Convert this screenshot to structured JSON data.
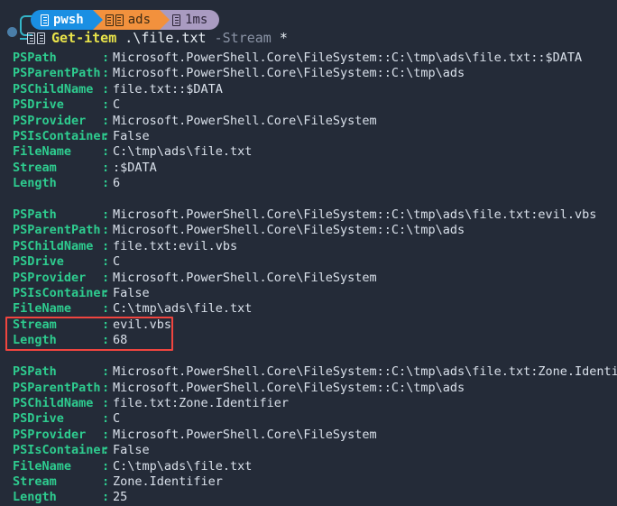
{
  "terminal": {
    "background_color": "#242b38",
    "prompt": {
      "segments": [
        {
          "name": "shell",
          "label": "pwsh",
          "icon": "terminal-glyph-icon",
          "bg_color": "#1a8fe3",
          "fg_color": "#ffffff"
        },
        {
          "name": "directory",
          "label": "ads",
          "icon": "folder-glyph-icon",
          "bg_color": "#f2913d",
          "fg_color": "#3b2a14"
        },
        {
          "name": "duration",
          "label": "1ms",
          "icon": "clock-glyph-icon",
          "bg_color": "#a99bc1",
          "fg_color": "#2b2438"
        }
      ],
      "command": {
        "icon": "prompt-glyph-icon",
        "name": "Get-item",
        "arg": " .\\file.txt",
        "param": " -Stream",
        "star": " *"
      }
    },
    "highlight": {
      "color": "#f0453f",
      "target_rows": [
        "Stream",
        "Length"
      ],
      "target_block_index": 1
    },
    "blocks": [
      {
        "id": "stream-data-default",
        "rows": [
          {
            "key": "PSPath",
            "colon": ":",
            "value": "Microsoft.PowerShell.Core\\FileSystem::C:\\tmp\\ads\\file.txt::$DATA"
          },
          {
            "key": "PSParentPath",
            "colon": ":",
            "value": "Microsoft.PowerShell.Core\\FileSystem::C:\\tmp\\ads"
          },
          {
            "key": "PSChildName",
            "colon": ":",
            "value": "file.txt::$DATA"
          },
          {
            "key": "PSDrive",
            "colon": ":",
            "value": "C"
          },
          {
            "key": "PSProvider",
            "colon": ":",
            "value": "Microsoft.PowerShell.Core\\FileSystem"
          },
          {
            "key": "PSIsContainer",
            "colon": ":",
            "value": "False"
          },
          {
            "key": "FileName",
            "colon": ":",
            "value": "C:\\tmp\\ads\\file.txt"
          },
          {
            "key": "Stream",
            "colon": ":",
            "value": ":$DATA"
          },
          {
            "key": "Length",
            "colon": ":",
            "value": "6"
          }
        ]
      },
      {
        "id": "stream-evil-vbs",
        "rows": [
          {
            "key": "PSPath",
            "colon": ":",
            "value": "Microsoft.PowerShell.Core\\FileSystem::C:\\tmp\\ads\\file.txt:evil.vbs"
          },
          {
            "key": "PSParentPath",
            "colon": ":",
            "value": "Microsoft.PowerShell.Core\\FileSystem::C:\\tmp\\ads"
          },
          {
            "key": "PSChildName",
            "colon": ":",
            "value": "file.txt:evil.vbs"
          },
          {
            "key": "PSDrive",
            "colon": ":",
            "value": "C"
          },
          {
            "key": "PSProvider",
            "colon": ":",
            "value": "Microsoft.PowerShell.Core\\FileSystem"
          },
          {
            "key": "PSIsContainer",
            "colon": ":",
            "value": "False"
          },
          {
            "key": "FileName",
            "colon": ":",
            "value": "C:\\tmp\\ads\\file.txt"
          },
          {
            "key": "Stream",
            "colon": ":",
            "value": "evil.vbs"
          },
          {
            "key": "Length",
            "colon": ":",
            "value": "68"
          }
        ]
      },
      {
        "id": "stream-zone-identifier",
        "rows": [
          {
            "key": "PSPath",
            "colon": ":",
            "value": "Microsoft.PowerShell.Core\\FileSystem::C:\\tmp\\ads\\file.txt:Zone.Identifier"
          },
          {
            "key": "PSParentPath",
            "colon": ":",
            "value": "Microsoft.PowerShell.Core\\FileSystem::C:\\tmp\\ads"
          },
          {
            "key": "PSChildName",
            "colon": ":",
            "value": "file.txt:Zone.Identifier"
          },
          {
            "key": "PSDrive",
            "colon": ":",
            "value": "C"
          },
          {
            "key": "PSProvider",
            "colon": ":",
            "value": "Microsoft.PowerShell.Core\\FileSystem"
          },
          {
            "key": "PSIsContainer",
            "colon": ":",
            "value": "False"
          },
          {
            "key": "FileName",
            "colon": ":",
            "value": "C:\\tmp\\ads\\file.txt"
          },
          {
            "key": "Stream",
            "colon": ":",
            "value": "Zone.Identifier"
          },
          {
            "key": "Length",
            "colon": ":",
            "value": "25"
          }
        ]
      }
    ]
  }
}
